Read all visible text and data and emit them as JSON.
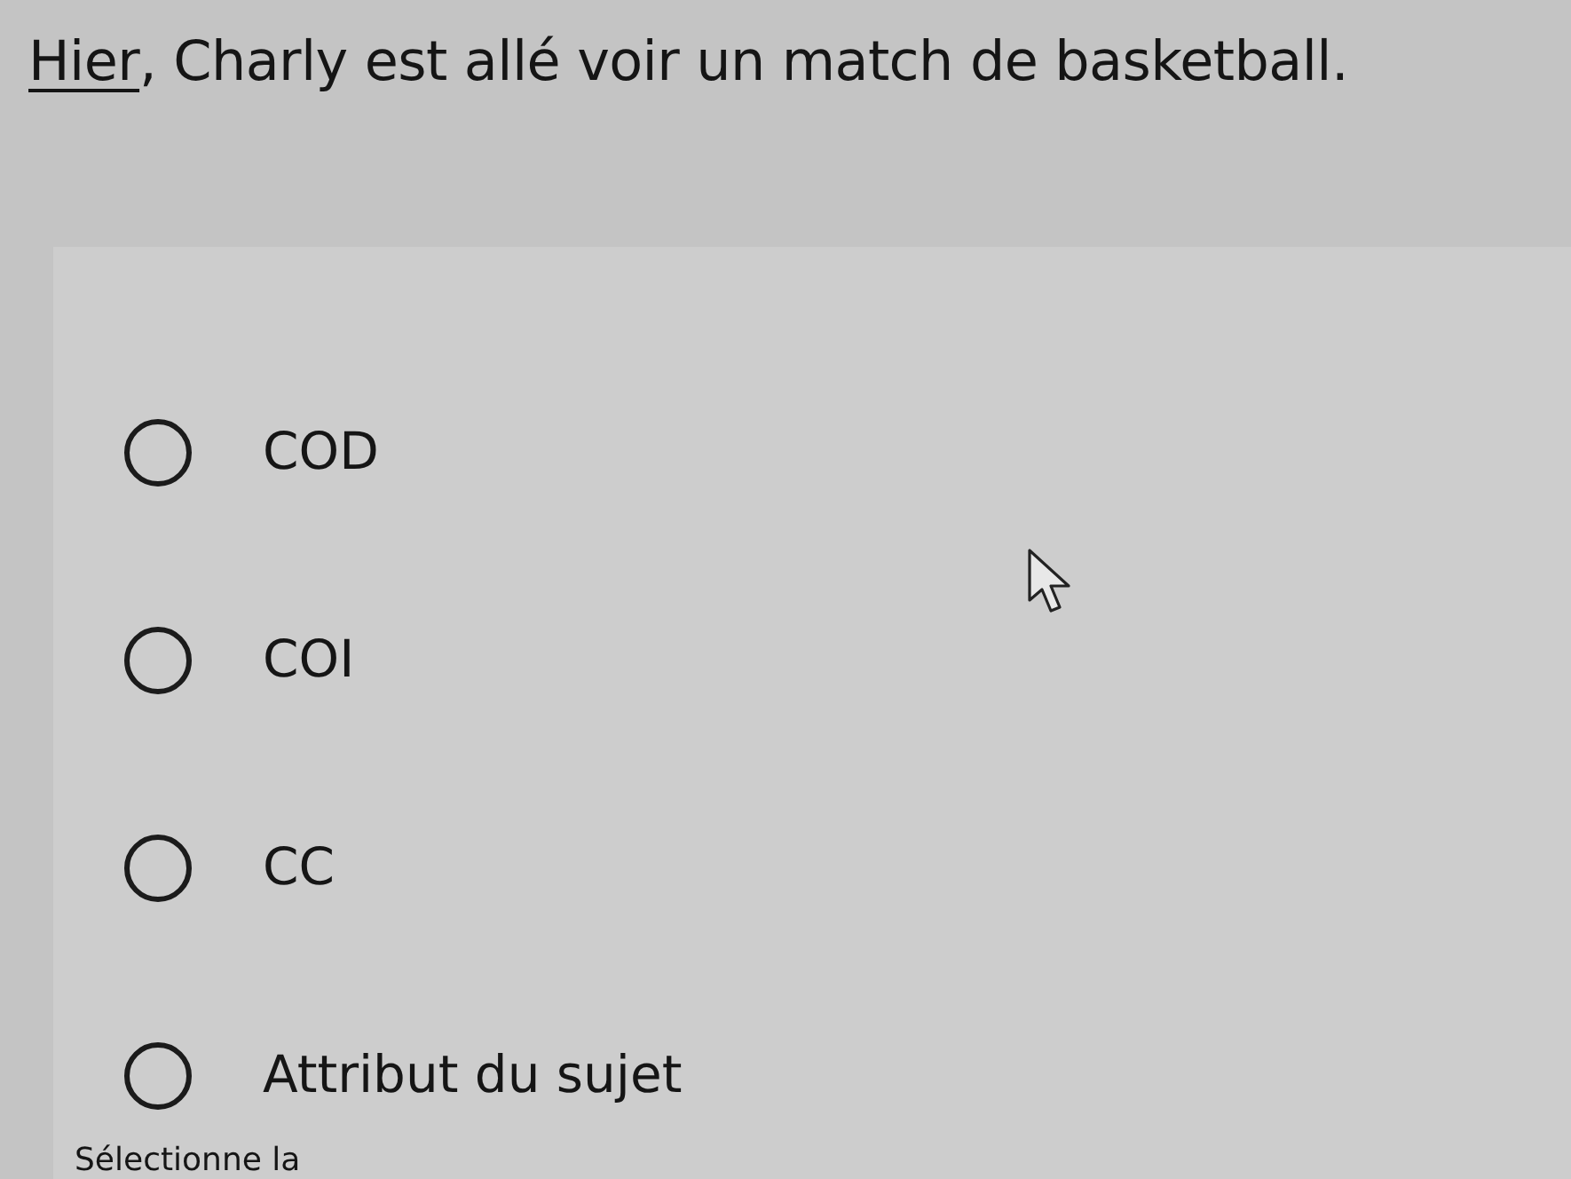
{
  "question": {
    "underlined": "Hier",
    "rest": ", Charly est allé voir un match de basketball."
  },
  "options": [
    {
      "label": "COD",
      "selected": false
    },
    {
      "label": "COI",
      "selected": false
    },
    {
      "label": "CC",
      "selected": false
    },
    {
      "label": "Attribut du sujet",
      "selected": false
    }
  ],
  "instruction": "Sélectionne la"
}
